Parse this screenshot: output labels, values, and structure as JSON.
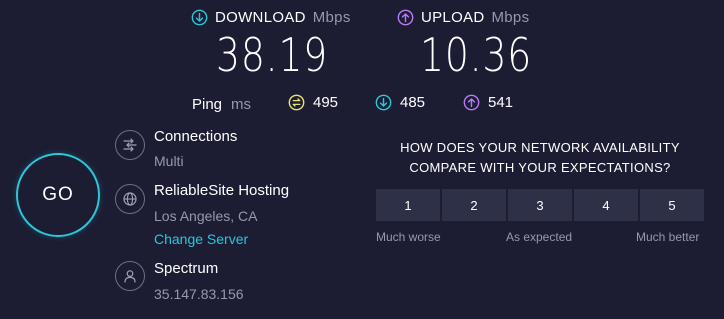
{
  "download": {
    "label": "DOWNLOAD",
    "unit": "Mbps",
    "value": "38.19",
    "icon": "download-arrow-icon",
    "color": "#2bc6d9"
  },
  "upload": {
    "label": "UPLOAD",
    "unit": "Mbps",
    "value": "10.36",
    "icon": "upload-arrow-icon",
    "color": "#b77bf6"
  },
  "ping": {
    "label": "Ping",
    "unit": "ms",
    "idle": {
      "value": "495",
      "icon": "ping-idle-icon",
      "color": "#e8e173"
    },
    "download": {
      "value": "485",
      "icon": "ping-download-icon",
      "color": "#2bc6d9"
    },
    "upload": {
      "value": "541",
      "icon": "ping-upload-icon",
      "color": "#b77bf6"
    }
  },
  "go_button": {
    "label": "GO"
  },
  "connections": {
    "title": "Connections",
    "value": "Multi",
    "icon": "connections-icon"
  },
  "server": {
    "title": "ReliableSite Hosting",
    "location": "Los Angeles, CA",
    "change_link": "Change Server",
    "icon": "globe-icon"
  },
  "provider": {
    "title": "Spectrum",
    "ip": "35.147.83.156",
    "icon": "user-icon"
  },
  "survey": {
    "question_line1": "HOW DOES YOUR NETWORK AVAILABILITY",
    "question_line2": "COMPARE WITH YOUR EXPECTATIONS?",
    "options": [
      "1",
      "2",
      "3",
      "4",
      "5"
    ],
    "label_low": "Much worse",
    "label_mid": "As expected",
    "label_high": "Much better"
  }
}
